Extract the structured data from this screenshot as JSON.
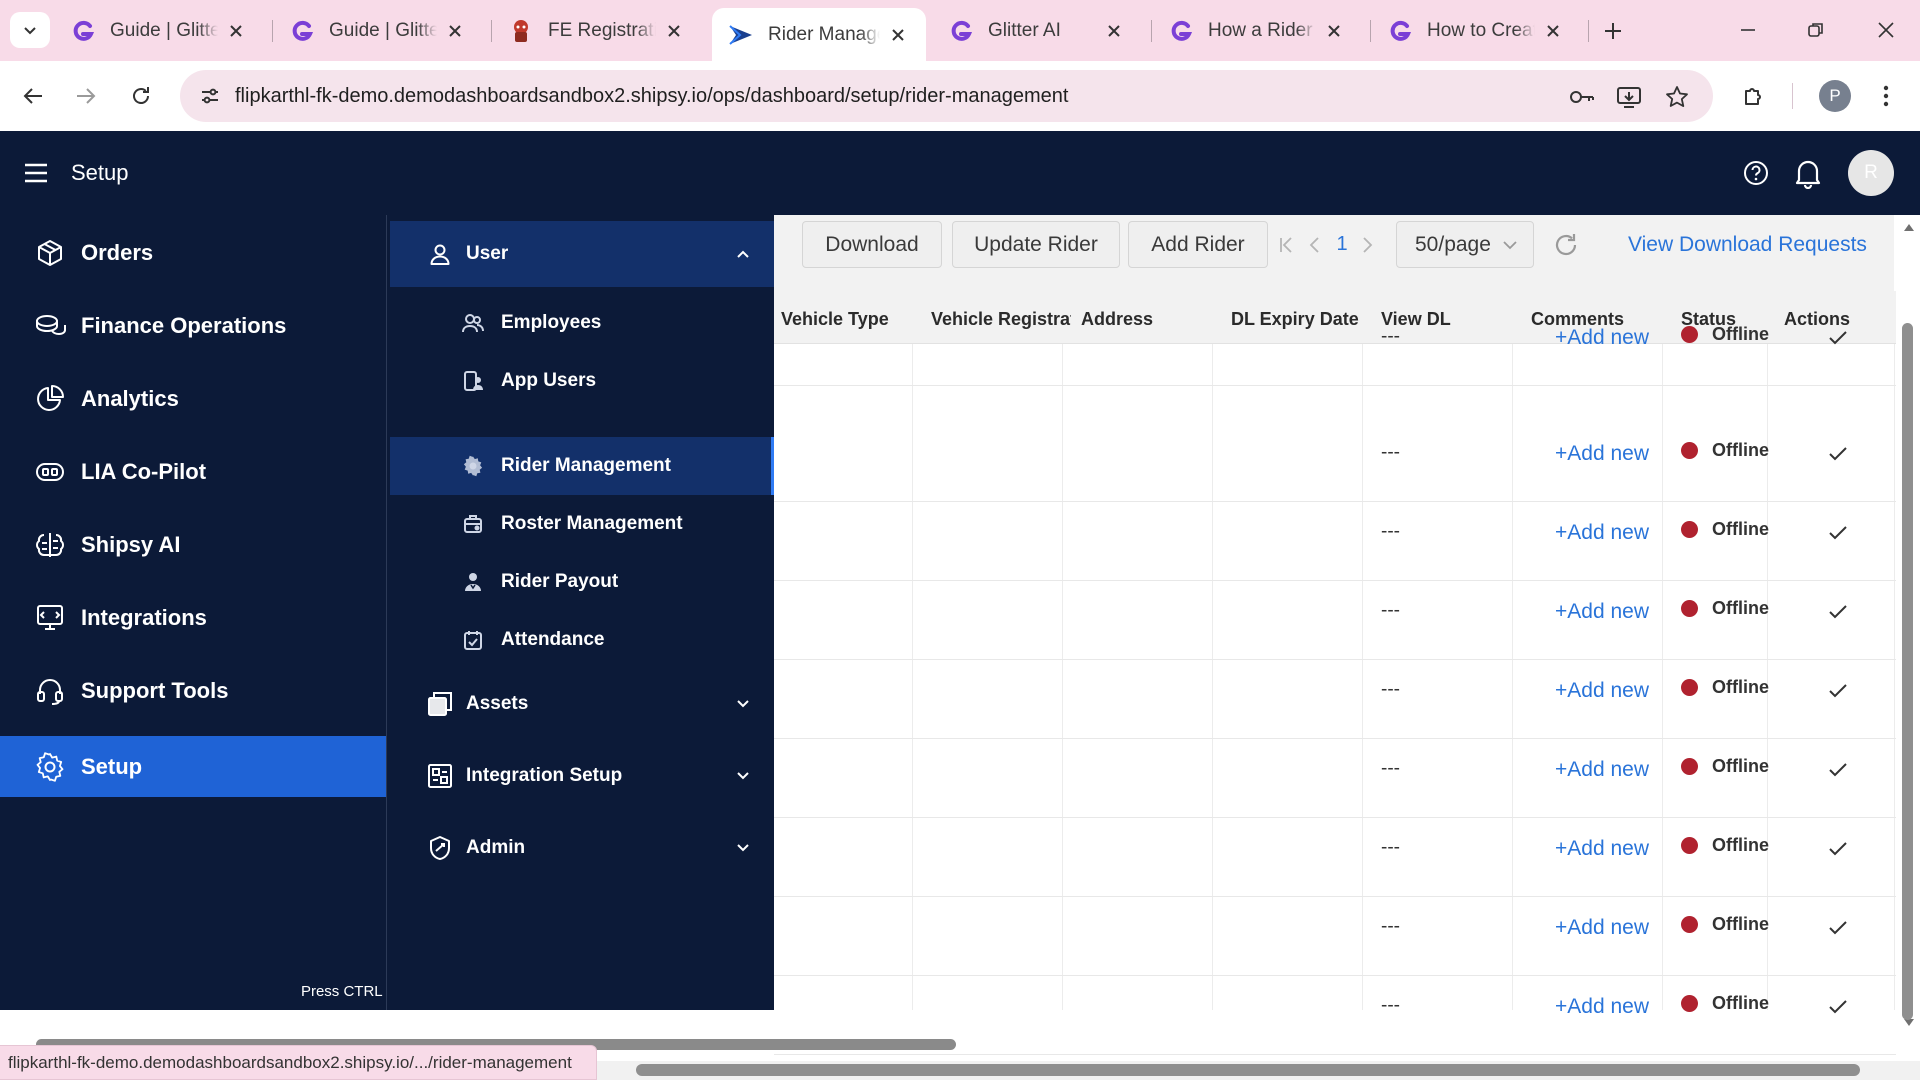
{
  "browser": {
    "tabs": [
      {
        "title": "Guide | Glitter AI",
        "favicon": "glitter-g-icon",
        "active": false
      },
      {
        "title": "Guide | Glitter AI",
        "favicon": "glitter-g-icon",
        "active": false
      },
      {
        "title": "FE Registration",
        "favicon": "mascot-favicon-icon",
        "active": false
      },
      {
        "title": "Rider Management",
        "favicon": "shipsy-arrow-icon",
        "active": true
      },
      {
        "title": "Glitter AI",
        "favicon": "glitter-g-icon",
        "active": false
      },
      {
        "title": "How a Rider r",
        "favicon": "glitter-g-icon",
        "active": false
      },
      {
        "title": "How to Create",
        "favicon": "glitter-g-icon",
        "active": false
      }
    ],
    "url": "flipkarthl-fk-demo.demodashboardsandbox2.shipsy.io/ops/dashboard/setup/rider-management",
    "profile_initial": "P",
    "status_url": "flipkarthl-fk-demo.demodashboardsandbox2.shipsy.io/.../rider-management"
  },
  "header": {
    "title": "Setup",
    "avatar_initial": "R"
  },
  "sidebar": {
    "items": [
      {
        "label": "Orders",
        "icon": "cube-icon",
        "active": false
      },
      {
        "label": "Finance Operations",
        "icon": "coins-icon",
        "active": false
      },
      {
        "label": "Analytics",
        "icon": "pie-chart-icon",
        "active": false
      },
      {
        "label": "LIA Co-Pilot",
        "icon": "copilot-icon",
        "active": false
      },
      {
        "label": "Shipsy AI",
        "icon": "ai-brain-icon",
        "active": false
      },
      {
        "label": "Integrations",
        "icon": "integrations-icon",
        "active": false
      },
      {
        "label": "Support Tools",
        "icon": "headset-icon",
        "active": false
      },
      {
        "label": "Setup",
        "icon": "gear-icon",
        "active": true
      }
    ],
    "footer": "Press CTRL + K to search"
  },
  "submenu": {
    "user": {
      "label": "User",
      "icon": "user-icon"
    },
    "user_items": [
      {
        "label": "Employees",
        "icon": "employees-icon",
        "active": false
      },
      {
        "label": "App Users",
        "icon": "app-users-icon",
        "active": false
      },
      {
        "label": "Rider Management",
        "icon": "rider-management-icon",
        "active": true
      },
      {
        "label": "Roster Management",
        "icon": "roster-icon",
        "active": false
      },
      {
        "label": "Rider Payout",
        "icon": "payout-icon",
        "active": false
      },
      {
        "label": "Attendance",
        "icon": "attendance-icon",
        "active": false
      }
    ],
    "groups": [
      {
        "label": "Assets",
        "icon": "assets-icon"
      },
      {
        "label": "Integration Setup",
        "icon": "integration-setup-icon"
      },
      {
        "label": "Admin",
        "icon": "admin-shield-icon"
      }
    ]
  },
  "toolbar": {
    "download": "Download",
    "update_rider": "Update Rider",
    "add_rider": "Add Rider",
    "page": "1",
    "page_size": "50/page",
    "view_download_requests": "View Download Requests"
  },
  "table": {
    "columns": [
      "Vehicle Type",
      "Vehicle Registration",
      "Address",
      "DL Expiry Date",
      "View DL",
      "Comments",
      "Status",
      "Actions"
    ],
    "rows": [
      {
        "view_dl": "---",
        "comments": "+Add new",
        "status": "Offline"
      },
      {
        "view_dl": "---",
        "comments": "+Add new",
        "status": "Offline"
      },
      {
        "view_dl": "---",
        "comments": "+Add new",
        "status": "Offline"
      },
      {
        "view_dl": "---",
        "comments": "+Add new",
        "status": "Offline"
      },
      {
        "view_dl": "---",
        "comments": "+Add new",
        "status": "Offline"
      },
      {
        "view_dl": "---",
        "comments": "+Add new",
        "status": "Offline"
      },
      {
        "view_dl": "---",
        "comments": "+Add new",
        "status": "Offline"
      },
      {
        "view_dl": "---",
        "comments": "+Add new",
        "status": "Offline"
      },
      {
        "view_dl": "---",
        "comments": "+Add new",
        "status": "Offline"
      }
    ]
  },
  "colors": {
    "nav_bg": "#0c1a38",
    "active_item": "#1f63d6",
    "link": "#2a74d9",
    "offline_dot": "#b0222f",
    "tabstrip": "#f8dbe8"
  }
}
